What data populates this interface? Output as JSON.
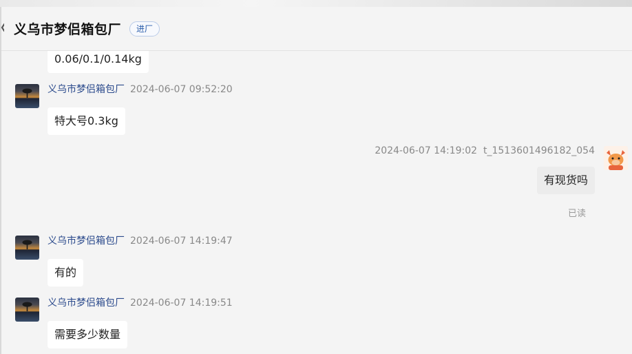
{
  "header": {
    "title": "义乌市梦侣箱包厂",
    "badge": "进厂"
  },
  "messages": [
    {
      "sender": "",
      "time": "",
      "text": "0.06/0.1/0.14kg"
    },
    {
      "sender": "义乌市梦侣箱包厂",
      "time": "2024-06-07 09:52:20",
      "text": "特大号0.3kg"
    },
    {
      "sender": "t_1513601496182_054",
      "time": "2024-06-07 14:19:02",
      "text": "有现货吗",
      "status": "已读"
    },
    {
      "sender": "义乌市梦侣箱包厂",
      "time": "2024-06-07 14:19:47",
      "text": "有的"
    },
    {
      "sender": "义乌市梦侣箱包厂",
      "time": "2024-06-07 14:19:51",
      "text": "需要多少数量"
    }
  ],
  "colors": {
    "name": "#2b4a8c",
    "badge": "#2a5caa",
    "self_bubble": "#ececec"
  }
}
